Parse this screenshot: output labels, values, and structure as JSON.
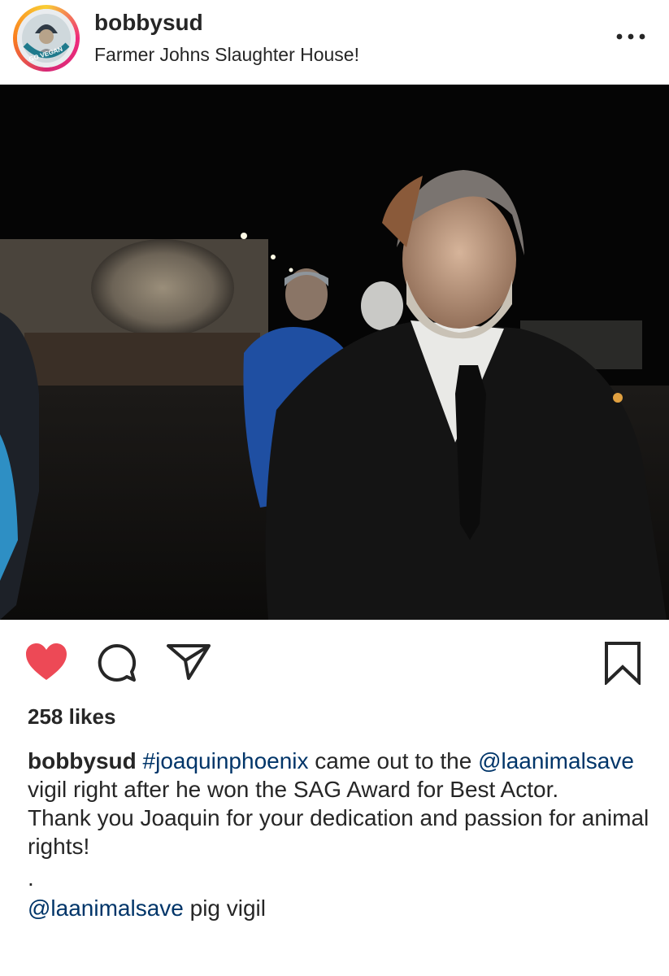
{
  "header": {
    "username": "bobbysud",
    "location": "Farmer Johns Slaughter House!",
    "avatar_text": "GO VEGAN",
    "more_icon": "more-horizontal-icon"
  },
  "post": {
    "image_alt": "Man in black suit at night vigil outside a slaughterhouse"
  },
  "actions": {
    "like_icon": "heart-filled-icon",
    "comment_icon": "comment-icon",
    "share_icon": "send-icon",
    "save_icon": "bookmark-icon",
    "like_color": "#ed4956"
  },
  "likes": "258 likes",
  "caption": {
    "username": "bobbysud",
    "hashtag": "#joaquinphoenix",
    "text1": " came out to the",
    "mention1": "@laanimalsave",
    "text2": " vigil right after he won the SAG Award for Best Actor.",
    "text3": "Thank you Joaquin for your dedication and passion for animal rights!",
    "dot": ".",
    "mention2": "@laanimalsave",
    "text4": " pig vigil"
  }
}
